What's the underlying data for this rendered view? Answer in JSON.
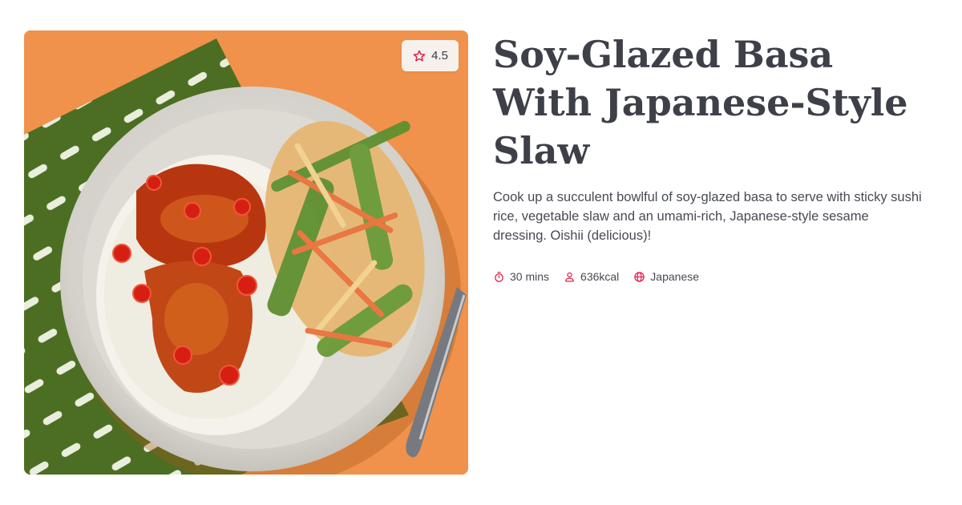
{
  "recipe": {
    "rating": "4.5",
    "title": "Soy-Glazed Basa With Japanese-Style Slaw",
    "description": "Cook up a succulent bowlful of soy-glazed basa to serve with sticky sushi rice, vegetable slaw and an umami-rich, Japanese-style sesame dressing. Oishii (delicious)!",
    "meta": {
      "time": "30 mins",
      "calories": "636kcal",
      "cuisine": "Japanese"
    }
  },
  "colors": {
    "accent": "#e0224f",
    "title": "#3e4049",
    "body": "#474a53",
    "backdrop": "#ef8e45",
    "napkin": "#4c6e22"
  },
  "icons": {
    "rating": "star-icon",
    "time": "stopwatch-icon",
    "calories": "person-icon",
    "cuisine": "globe-icon"
  }
}
